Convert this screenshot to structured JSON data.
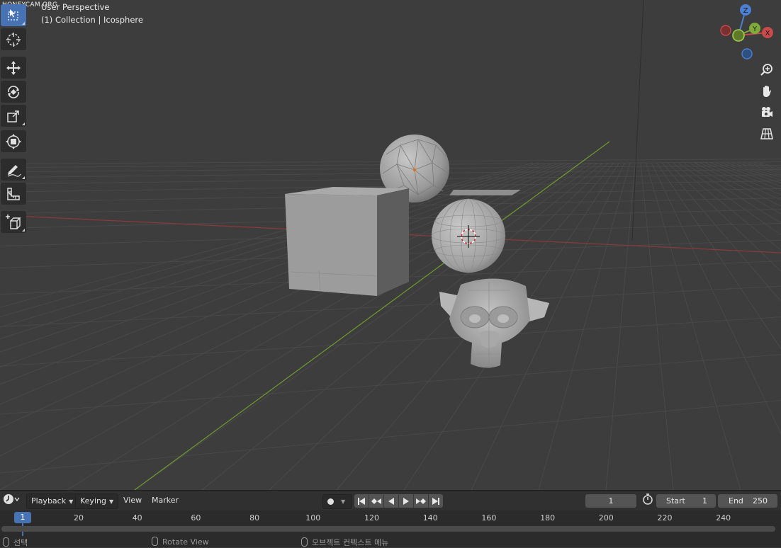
{
  "watermark": "HONEYCAM.ORG",
  "viewport": {
    "perspective_label": "User Perspective",
    "collection_label": "(1) Collection | Icosphere"
  },
  "gizmo": {
    "z": "Z",
    "y": "Y",
    "x": "X"
  },
  "toolbar": {
    "tools": [
      "select-box",
      "cursor",
      "move",
      "rotate",
      "scale",
      "transform",
      "annotate",
      "measure",
      "add-cube"
    ]
  },
  "nav": [
    "zoom-icon",
    "hand-pan-icon",
    "camera-icon",
    "grid-ortho-icon"
  ],
  "timeline": {
    "menus": {
      "playback": "Playback",
      "keying": "Keying",
      "view": "View",
      "marker": "Marker"
    },
    "current_frame": "1",
    "start_label": "Start",
    "start_value": "1",
    "end_label": "End",
    "end_value": "250",
    "ruler_current": "1",
    "ruler_ticks": [
      "20",
      "40",
      "60",
      "80",
      "100",
      "120",
      "140",
      "160",
      "180",
      "200",
      "220",
      "240"
    ]
  },
  "statusbar": {
    "select": "선택",
    "rotate_view": "Rotate View",
    "context_menu": "오브젝트 컨텍스트 메뉴"
  },
  "colors": {
    "accent": "#4772b3",
    "axis_x": "#c94a4a",
    "axis_y": "#7fab3a",
    "axis_z": "#4a7fd1",
    "viewport_bg": "#3d3d3d"
  }
}
